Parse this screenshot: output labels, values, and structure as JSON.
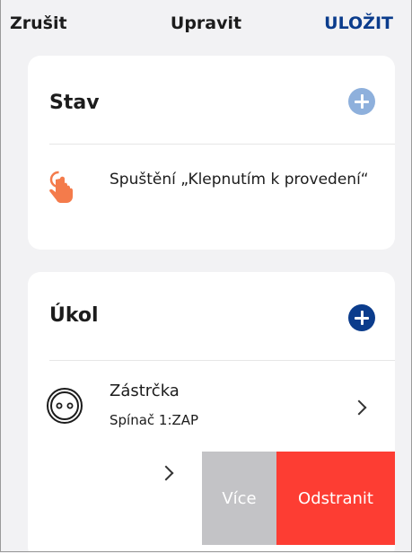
{
  "nav": {
    "cancel_label": "Zrušit",
    "title": "Upravit",
    "save_label": "ULOŽIT"
  },
  "condition": {
    "title": "Stav",
    "trigger_text": "Spuštění „Klepnutím k provedení“",
    "trigger_icon": "tap-hand-icon"
  },
  "task": {
    "title": "Úkol",
    "device": {
      "name": "Zástrčka",
      "state": "Spínač 1:ZAP",
      "icon": "socket-icon"
    },
    "swipe_actions": {
      "more_label": "Více",
      "delete_label": "Odstranit"
    }
  },
  "colors": {
    "accent": "#0b3c8c",
    "add_disabled": "#8eb0dc",
    "delete": "#fd3d33",
    "more": "#c3c3c6",
    "tap_icon": "#f47b4b"
  }
}
